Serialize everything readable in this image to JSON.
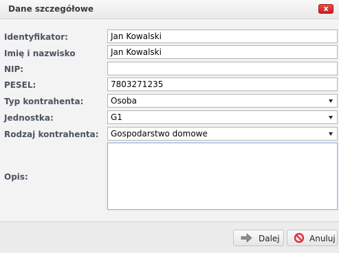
{
  "dialog": {
    "title": "Dane szczegółowe",
    "close_label": "x"
  },
  "form": {
    "identyfikator": {
      "label": "Identyfikator:",
      "value": "Jan Kowalski"
    },
    "imie_nazwisko": {
      "label": "Imię i nazwisko",
      "value": "Jan Kowalski"
    },
    "nip": {
      "label": "NIP:",
      "value": ""
    },
    "pesel": {
      "label": "PESEL:",
      "value": "7803271235"
    },
    "typ": {
      "label": "Typ kontrahenta:",
      "value": "Osoba"
    },
    "jednostka": {
      "label": "Jednostka:",
      "value": "G1"
    },
    "rodzaj": {
      "label": "Rodzaj kontrahenta:",
      "value": "Gospodarstwo domowe"
    },
    "opis": {
      "label": "Opis:",
      "value": ""
    }
  },
  "buttons": {
    "next": "Dalej",
    "cancel": "Anuluj"
  },
  "icons": {
    "close": "close-icon",
    "next": "arrow-right-icon",
    "cancel": "cancel-icon",
    "dropdown": "chevron-down-icon"
  },
  "colors": {
    "close_button": "#d32f2f",
    "label_text": "#4b5361"
  }
}
